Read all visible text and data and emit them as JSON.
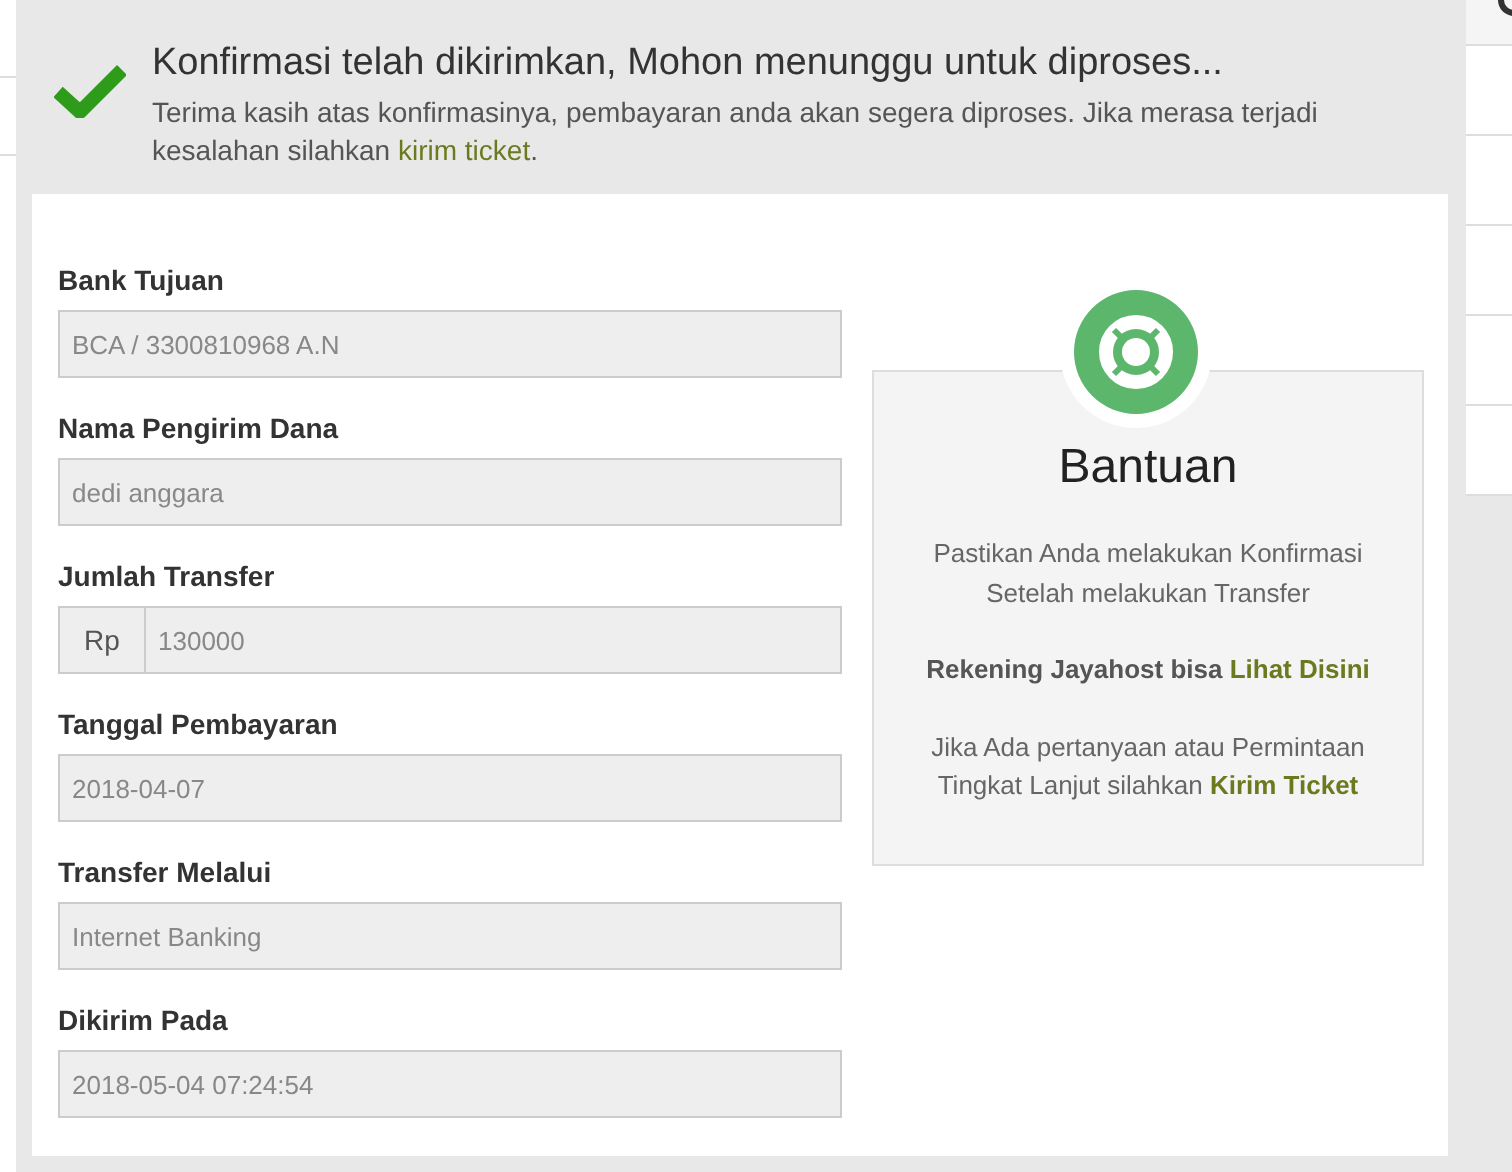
{
  "alert": {
    "title": "Konfirmasi telah dikirimkan, Mohon menunggu untuk diproses...",
    "message": "Terima kasih atas konfirmasinya, pembayaran anda akan segera diproses. Jika merasa terjadi kesalahan silahkan ",
    "link": "kirim ticket",
    "message_end": "."
  },
  "fields": [
    {
      "label": "Bank Tujuan",
      "value": "BCA / 3300810968 A.N",
      "kind": "text",
      "disabled": true
    },
    {
      "label": "Nama Pengirim Dana",
      "value": "dedi anggara",
      "kind": "text",
      "disabled": true
    },
    {
      "label": "Jumlah Transfer",
      "value": "130000",
      "kind": "addon",
      "addon": "Rp",
      "disabled": true
    },
    {
      "label": "Tanggal Pembayaran",
      "value": "2018-04-07",
      "kind": "text",
      "disabled": true
    },
    {
      "label": "Transfer Melalui",
      "value": "Internet Banking",
      "kind": "text",
      "disabled": true
    },
    {
      "label": "Dikirim Pada",
      "value": "2018-05-04 07:24:54",
      "kind": "text",
      "disabled": true
    }
  ],
  "help": {
    "title": "Bantuan",
    "paragraphs": [
      {
        "parts": [
          {
            "kind": "plain",
            "text": "Pastikan Anda melakukan Konfirmasi Setelah melakukan Transfer"
          }
        ]
      },
      {
        "parts": [
          {
            "kind": "bold",
            "text": "Rekening Jayahost bisa "
          },
          {
            "kind": "link",
            "text": "Lihat Disini"
          }
        ]
      },
      {
        "parts": [
          {
            "kind": "plain",
            "text": "Jika Ada pertanyaan atau Permintaan Tingkat Lanjut silahkan "
          },
          {
            "kind": "link",
            "text": "Kirim Ticket"
          }
        ]
      }
    ]
  }
}
